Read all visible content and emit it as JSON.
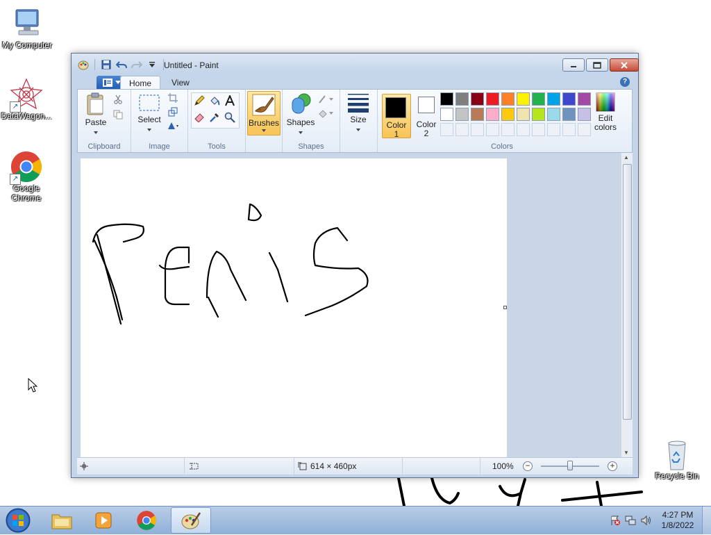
{
  "desktop": {
    "icons": [
      {
        "label": "My Computer"
      },
      {
        "label": "DataWagon..."
      },
      {
        "label": "Google Chrome"
      },
      {
        "label": "Recycle Bin"
      }
    ]
  },
  "window": {
    "title": "Untitled - Paint",
    "tabs": [
      {
        "label": "Home"
      },
      {
        "label": "View"
      }
    ],
    "ribbon": {
      "clipboard": {
        "group_label": "Clipboard",
        "paste_label": "Paste"
      },
      "image": {
        "group_label": "Image",
        "select_label": "Select"
      },
      "tools": {
        "group_label": "Tools"
      },
      "brushes": {
        "label": "Brushes"
      },
      "shapes": {
        "group_label": "Shapes",
        "shapes_label": "Shapes"
      },
      "size": {
        "label": "Size"
      },
      "colors": {
        "group_label": "Colors",
        "color1_label": "Color\n1",
        "color2_label": "Color\n2",
        "edit_colors_label": "Edit\ncolors",
        "color1": "#000000",
        "color2": "#ffffff",
        "palette_row1": [
          "#000000",
          "#7f7f7f",
          "#880015",
          "#ed1c24",
          "#ff7f27",
          "#fff200",
          "#22b14c",
          "#00a2e8",
          "#3f48cc",
          "#a349a4"
        ],
        "palette_row2": [
          "#ffffff",
          "#c3c3c3",
          "#b97a57",
          "#ffaec9",
          "#ffc90e",
          "#efe4b0",
          "#b5e61d",
          "#99d9ea",
          "#7092be",
          "#c8bfe7"
        ]
      }
    },
    "statusbar": {
      "image_size": "614 × 460px",
      "zoom": "100%"
    }
  },
  "taskbar": {
    "time": "4:27 PM",
    "date": "1/8/2022"
  },
  "icons": {
    "qat": [
      "paint-app-icon",
      "save-icon",
      "undo-icon",
      "redo-icon",
      "customize-qat-icon"
    ],
    "tray": [
      "action-center-icon",
      "network-icon",
      "volume-icon"
    ]
  }
}
